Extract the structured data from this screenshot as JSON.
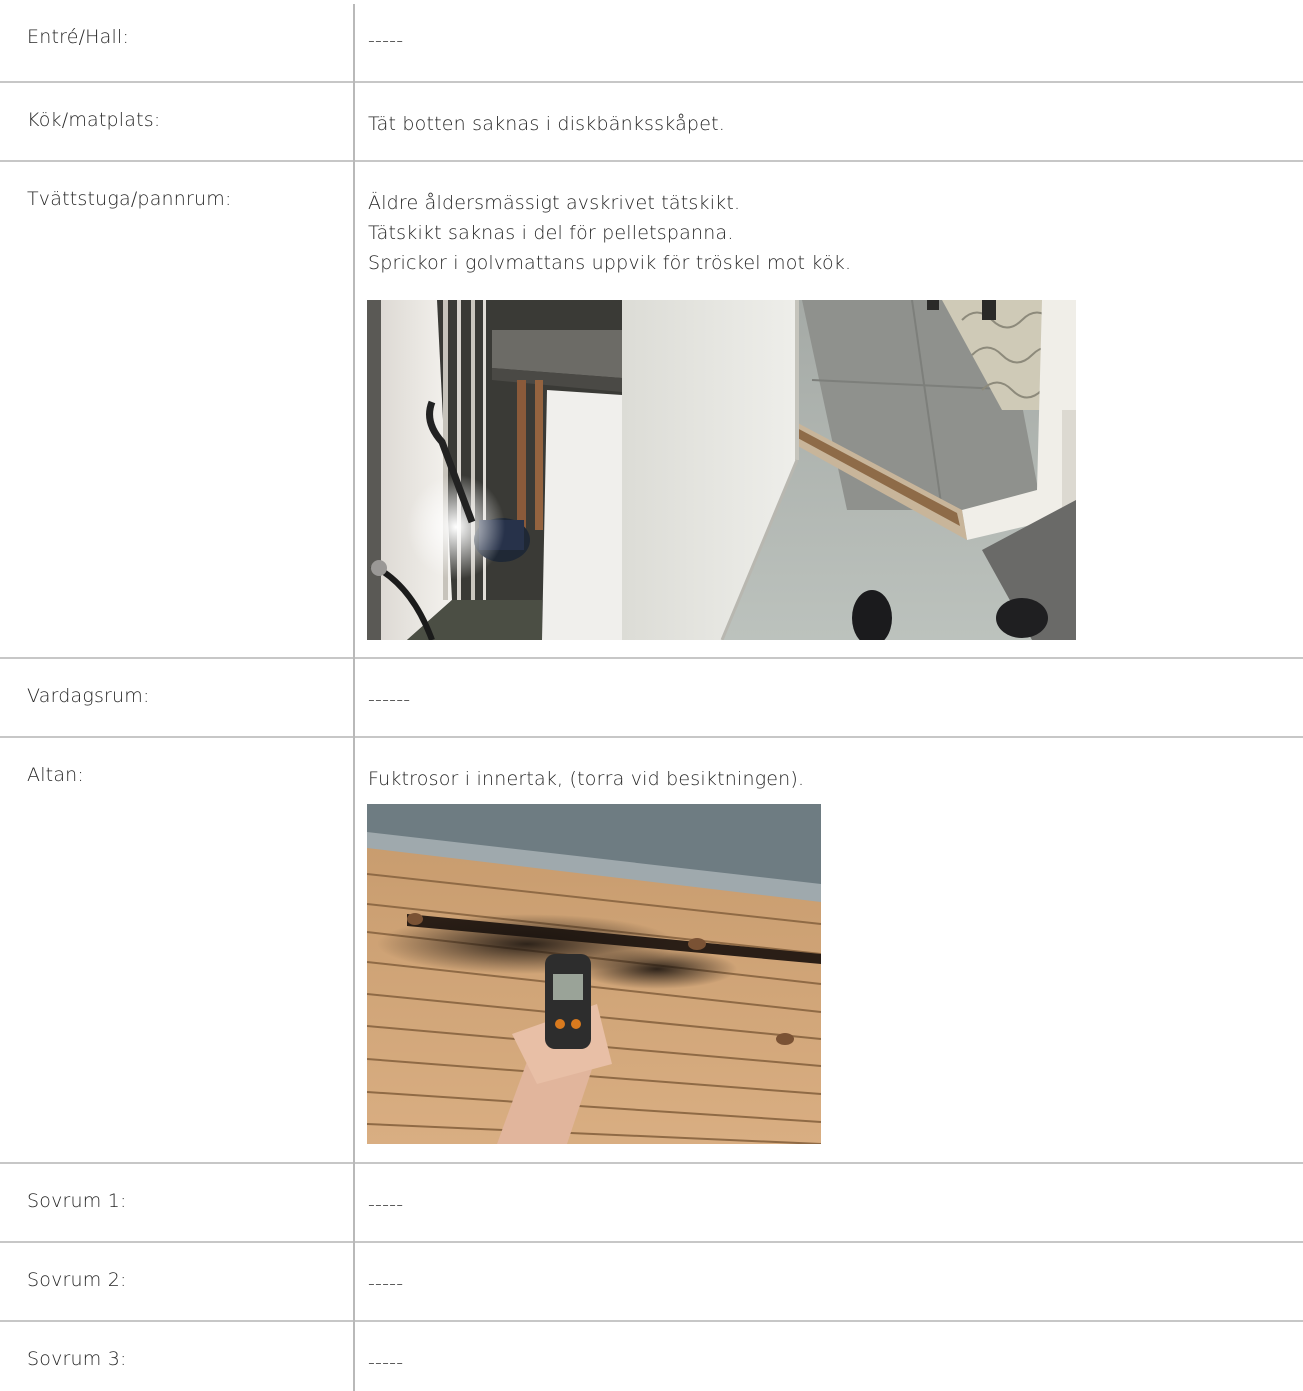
{
  "rows": [
    {
      "label": "Entré/Hall:",
      "lines": [
        "-----"
      ]
    },
    {
      "label": "Kök/matplats:",
      "lines": [
        "Tät botten saknas i diskbänksskåpet."
      ]
    },
    {
      "label": "Tvättstuga/pannrum:",
      "lines": [
        "Äldre åldersmässigt avskrivet tätskikt.",
        "Tätskikt saknas i del för pelletspanna.",
        "Sprickor i golvmattans uppvik för tröskel mot kök."
      ]
    },
    {
      "label": "Vardagsrum:",
      "lines": [
        "------"
      ]
    },
    {
      "label": "Altan:",
      "lines": [
        "Fuktrosor i innertak, (torra vid besiktningen)."
      ]
    },
    {
      "label": "Sovrum 1:",
      "lines": [
        "-----"
      ]
    },
    {
      "label": "Sovrum 2:",
      "lines": [
        "-----"
      ]
    },
    {
      "label": "Sovrum 3:",
      "lines": [
        "-----"
      ]
    }
  ],
  "colors": {
    "divider": "#c7c7c7",
    "text": "#262626"
  }
}
